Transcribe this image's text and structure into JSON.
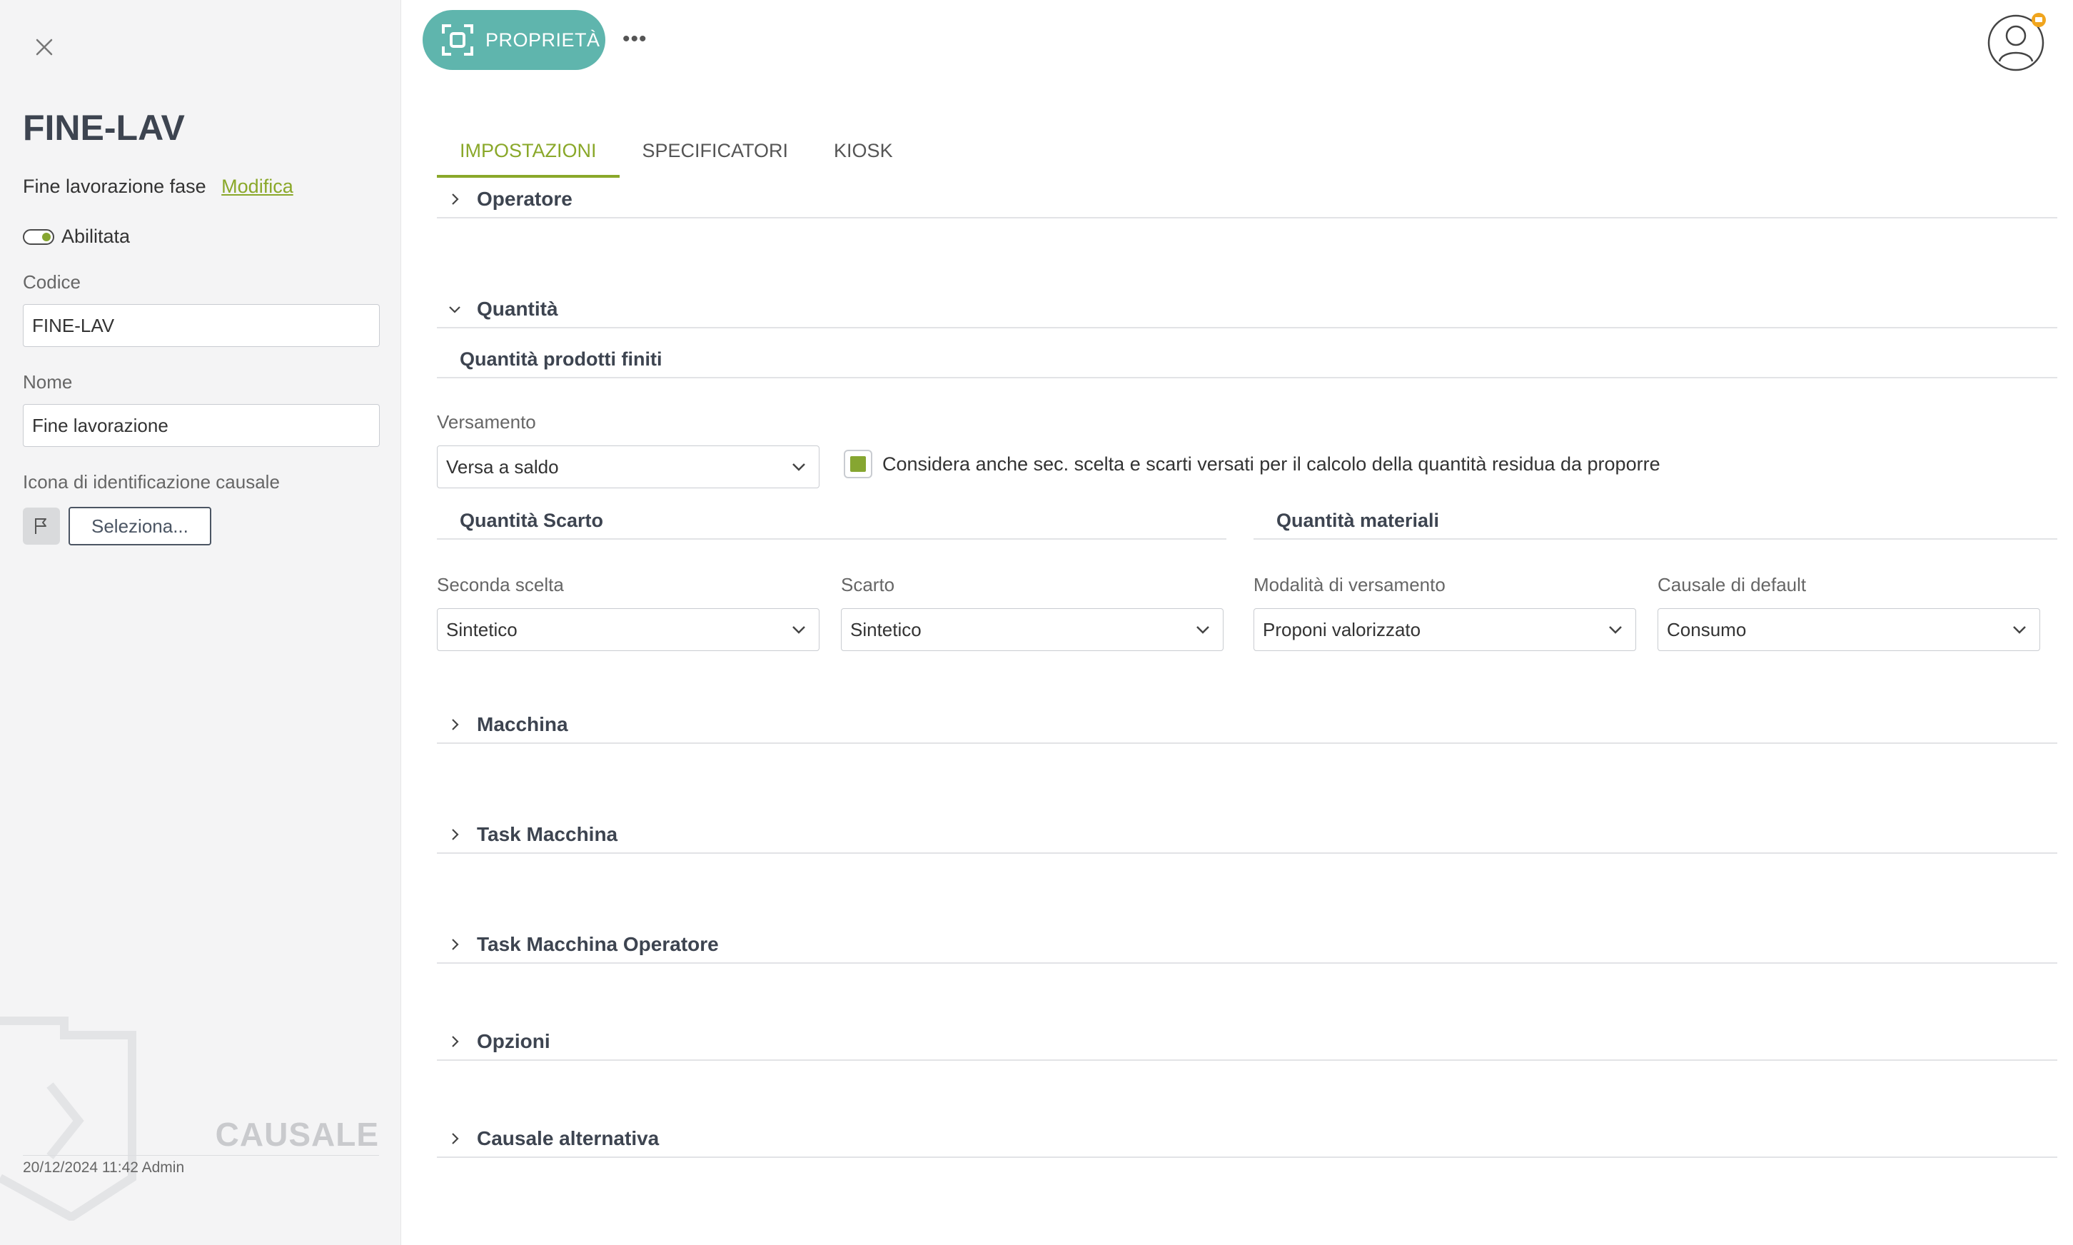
{
  "sidebar": {
    "title": "FINE-LAV",
    "subtitle": "Fine lavorazione fase",
    "edit_link": "Modifica",
    "toggle_label": "Abilitata",
    "code_label": "Codice",
    "code_value": "FINE-LAV",
    "name_label": "Nome",
    "name_value": "Fine lavorazione",
    "icon_label": "Icona di identificazione causale",
    "select_button": "Seleziona...",
    "entity_mark": "CAUSALE",
    "footer": "20/12/2024 11:42 Admin"
  },
  "header": {
    "properties_label": "PROPRIETÀ",
    "more_label": "•••"
  },
  "tabs": [
    {
      "label": "IMPOSTAZIONI",
      "active": true
    },
    {
      "label": "SPECIFICATORI",
      "active": false
    },
    {
      "label": "KIOSK",
      "active": false
    }
  ],
  "sections": {
    "operatore": "Operatore",
    "quantita": "Quantità",
    "macchina": "Macchina",
    "task_macchina": "Task Macchina",
    "task_macchina_operatore": "Task Macchina Operatore",
    "opzioni": "Opzioni",
    "causale_alternativa": "Causale alternativa"
  },
  "quantita": {
    "prodotti_finiti_title": "Quantità prodotti finiti",
    "versamento_label": "Versamento",
    "versamento_value": "Versa a saldo",
    "checkbox_label": "Considera anche sec. scelta e scarti versati per il calcolo della quantità residua da proporre",
    "checkbox_checked": true,
    "scarto_title": "Quantità Scarto",
    "materiali_title": "Quantità materiali",
    "seconda_scelta_label": "Seconda scelta",
    "seconda_scelta_value": "Sintetico",
    "scarto_label": "Scarto",
    "scarto_value": "Sintetico",
    "modalita_label": "Modalità di versamento",
    "modalita_value": "Proponi valorizzato",
    "causale_default_label": "Causale di default",
    "causale_default_value": "Consumo"
  },
  "colors": {
    "accent": "#8aa82a",
    "pill": "#5fb5ad",
    "sidebar_bg": "#f4f4f5"
  }
}
